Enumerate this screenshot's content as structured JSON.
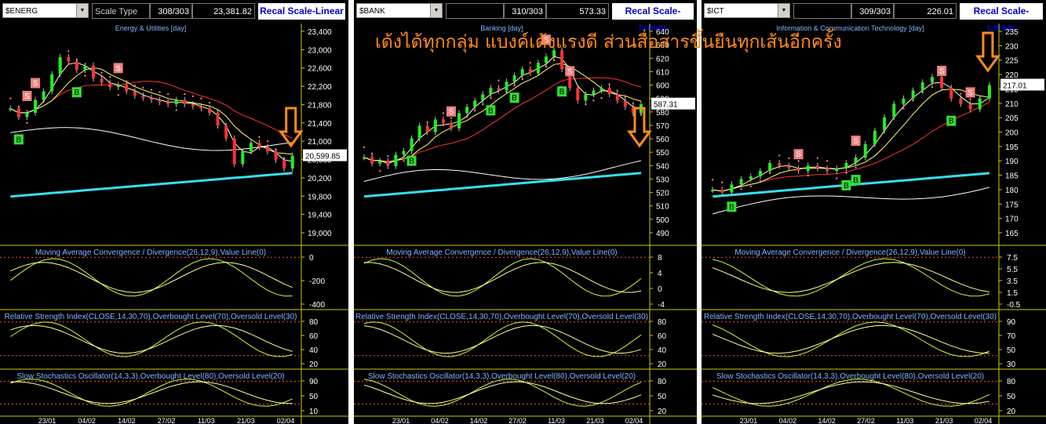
{
  "headline": "เด้งได้ทุกกลุ่ม แบงค์เด้งแรงดี ส่วนสื่อสารขึ้นยืนทุกเส้นอีกครั้ง",
  "panels": [
    {
      "symbol": "$ENERG",
      "scale_type_label": "Scale Type",
      "count": "308/303",
      "value": "23,381.82",
      "recal": "Recal Scale-Linear",
      "title": "Energy & Utilities [day]",
      "price_ticks": [
        "23,400",
        "23,000",
        "22,600",
        "22,200",
        "21,800",
        "21,400",
        "21,000",
        "20,600",
        "20,200",
        "19,800",
        "19,400",
        "19,000"
      ],
      "last_price": "20,599.85",
      "macd_title": "Moving Average Convergence / Divergence(26,12,9),Value Line(0)",
      "macd_ticks": [
        "0",
        "-200",
        "-400"
      ],
      "rsi_title": "Relative Strength Index(CLOSE,14,30,70),Overbought Level(70),Oversold Level(30)",
      "rsi_ticks": [
        "80",
        "60",
        "40",
        "20"
      ],
      "sto_title": "Slow Stochastics Oscillator(14,3,3),Overbought Level(80),Oversold Level(20)",
      "sto_ticks": [
        "90",
        "50",
        "10"
      ],
      "dates": [
        "23/01",
        "04/02",
        "14/02",
        "27/02",
        "11/03",
        "21/03",
        "02/04"
      ]
    },
    {
      "symbol": "$BANK",
      "count": "310/303",
      "value": "573.33",
      "recal": "Recal Scale-Linear",
      "title": "Banking [day]",
      "price_ticks": [
        "640",
        "630",
        "620",
        "610",
        "600",
        "590",
        "580",
        "570",
        "560",
        "550",
        "540",
        "530",
        "520",
        "510",
        "500",
        "490"
      ],
      "last_price": "587.31",
      "macd_title": "Moving Average Convergence / Divergence(26,12,9),Value Line(0)",
      "macd_ticks": [
        "8",
        "4",
        "0",
        "-4"
      ],
      "rsi_title": "Relative Strength Index(CLOSE,14,30,70),Overbought Level(70),Oversold Level(30)",
      "rsi_ticks": [
        "80",
        "60",
        "40",
        "20"
      ],
      "sto_title": "Slow Stochastics Oscillator(14,3,3),Overbought Level(80),Oversold Level(20)",
      "sto_ticks": [
        "80",
        "50",
        "20"
      ],
      "dates": [
        "23/01",
        "04/02",
        "14/02",
        "27/02",
        "11/03",
        "21/03",
        "02/04"
      ]
    },
    {
      "symbol": "$ICT",
      "count": "309/303",
      "value": "226.01",
      "recal": "Recal Scale-Linear",
      "title": "Information & Communication Technology [day]",
      "price_ticks": [
        "235",
        "230",
        "225",
        "220",
        "215",
        "210",
        "205",
        "200",
        "195",
        "190",
        "185",
        "180",
        "175",
        "170",
        "165"
      ],
      "last_price": "217.01",
      "macd_title": "Moving Average Convergence / Divergence(26,12,9),Value Line(0)",
      "macd_ticks": [
        "7.5",
        "5.5",
        "3.5",
        "1.5",
        "-0.5"
      ],
      "rsi_title": "Relative Strength Index(CLOSE,14,30,70),Overbought Level(70),Oversold Level(30)",
      "rsi_ticks": [
        "90",
        "70",
        "50",
        "30"
      ],
      "sto_title": "Slow Stochastics Oscillator(14,3,3),Overbought Level(80),Oversold Level(20)",
      "sto_ticks": [
        "80",
        "50",
        "20"
      ],
      "dates": [
        "23/01",
        "04/02",
        "14/02",
        "27/02",
        "11/03",
        "21/03",
        "02/04"
      ]
    }
  ],
  "chart_data": [
    {
      "type": "candlestick",
      "title": "Energy & Utilities [day]",
      "ylim": [
        18800,
        23500
      ],
      "closes": [
        21700,
        21500,
        21600,
        21900,
        22100,
        22500,
        22900,
        22800,
        22600,
        22700,
        22400,
        22300,
        22200,
        22250,
        22100,
        22000,
        21950,
        21900,
        21850,
        21800,
        21900,
        21800,
        21750,
        21700,
        21600,
        21300,
        21000,
        20400,
        20700,
        20900,
        20800,
        20700,
        20500,
        20300,
        20600
      ],
      "last": 20599.85,
      "signals_s": [
        2,
        3,
        13
      ],
      "signals_b": [
        1,
        8
      ]
    },
    {
      "type": "candlestick",
      "title": "Banking [day]",
      "ylim": [
        485,
        645
      ],
      "closes": [
        545,
        540,
        542,
        538,
        547,
        550,
        560,
        570,
        565,
        575,
        572,
        568,
        580,
        585,
        590,
        595,
        600,
        598,
        605,
        610,
        615,
        612,
        620,
        625,
        630,
        615,
        600,
        590,
        595,
        598,
        600,
        595,
        590,
        585,
        580,
        587
      ],
      "last": 587.31,
      "signals_s": [
        11,
        23,
        26
      ],
      "signals_b": [
        6,
        16,
        19,
        25
      ]
    },
    {
      "type": "candlestick",
      "title": "Information & Communication Technology [day]",
      "ylim": [
        162,
        237
      ],
      "closes": [
        178,
        177,
        180,
        182,
        183,
        185,
        188,
        187,
        186,
        185,
        187,
        186,
        185,
        186,
        188,
        190,
        195,
        200,
        205,
        210,
        212,
        215,
        218,
        220,
        216,
        212,
        210,
        208,
        212,
        217
      ],
      "last": 217.01,
      "signals_s": [
        9,
        15,
        24,
        27
      ],
      "signals_b": [
        2,
        14,
        15,
        25
      ]
    }
  ]
}
